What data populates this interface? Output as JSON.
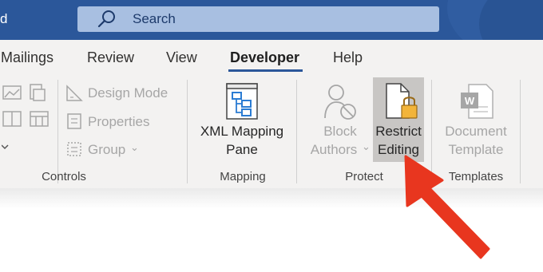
{
  "titlebar": {
    "title_fragment": "d",
    "search_label": "Search"
  },
  "tabs": [
    {
      "label": "Mailings"
    },
    {
      "label": "Review"
    },
    {
      "label": "View"
    },
    {
      "label": "Developer",
      "active": true
    },
    {
      "label": "Help"
    }
  ],
  "groups": {
    "controls": {
      "label": "Controls",
      "design_mode": "Design Mode",
      "properties": "Properties",
      "group": "Group"
    },
    "mapping": {
      "label": "Mapping",
      "xml_line1": "XML Mapping",
      "xml_line2": "Pane"
    },
    "protect": {
      "label": "Protect",
      "block_line1": "Block",
      "block_line2": "Authors",
      "restrict_line1": "Restrict",
      "restrict_line2": "Editing"
    },
    "templates": {
      "label": "Templates",
      "doc_line1": "Document",
      "doc_line2": "Template"
    }
  },
  "colors": {
    "accent": "#2b579a",
    "arrow": "#e8361f",
    "highlight": "#c8c6c4",
    "disabled_text": "#a6a6a6"
  },
  "icons": [
    "search-icon",
    "xml-mapping-icon",
    "block-authors-icon",
    "restrict-editing-icon",
    "document-template-icon",
    "arrow-annotation"
  ]
}
